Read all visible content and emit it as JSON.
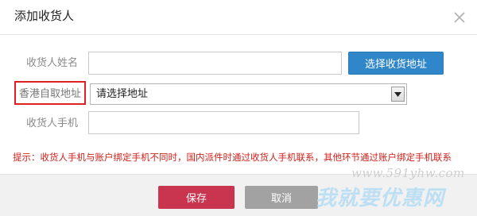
{
  "dialog": {
    "title": "添加收货人"
  },
  "form": {
    "name_label": "收货人姓名",
    "name_value": "",
    "select_address_button": "选择收货地址",
    "hk_label": "香港自取地址",
    "hk_select_value": "请选择地址",
    "phone_label": "收货人手机",
    "phone_value": ""
  },
  "hint": "提示：收货人手机与账户绑定手机不同时，国内派件时通过收货人手机联系，其他环节通过账户绑定手机联系",
  "footer": {
    "save_label": "保存",
    "cancel_label": "取消"
  },
  "watermark": {
    "url": "www.591yhw.com",
    "text": "我就要优惠网"
  },
  "colors": {
    "primary_blue": "#2f86c8",
    "save_red": "#c9344e",
    "hint_red": "#d2211b",
    "highlight_border": "#e02020"
  }
}
